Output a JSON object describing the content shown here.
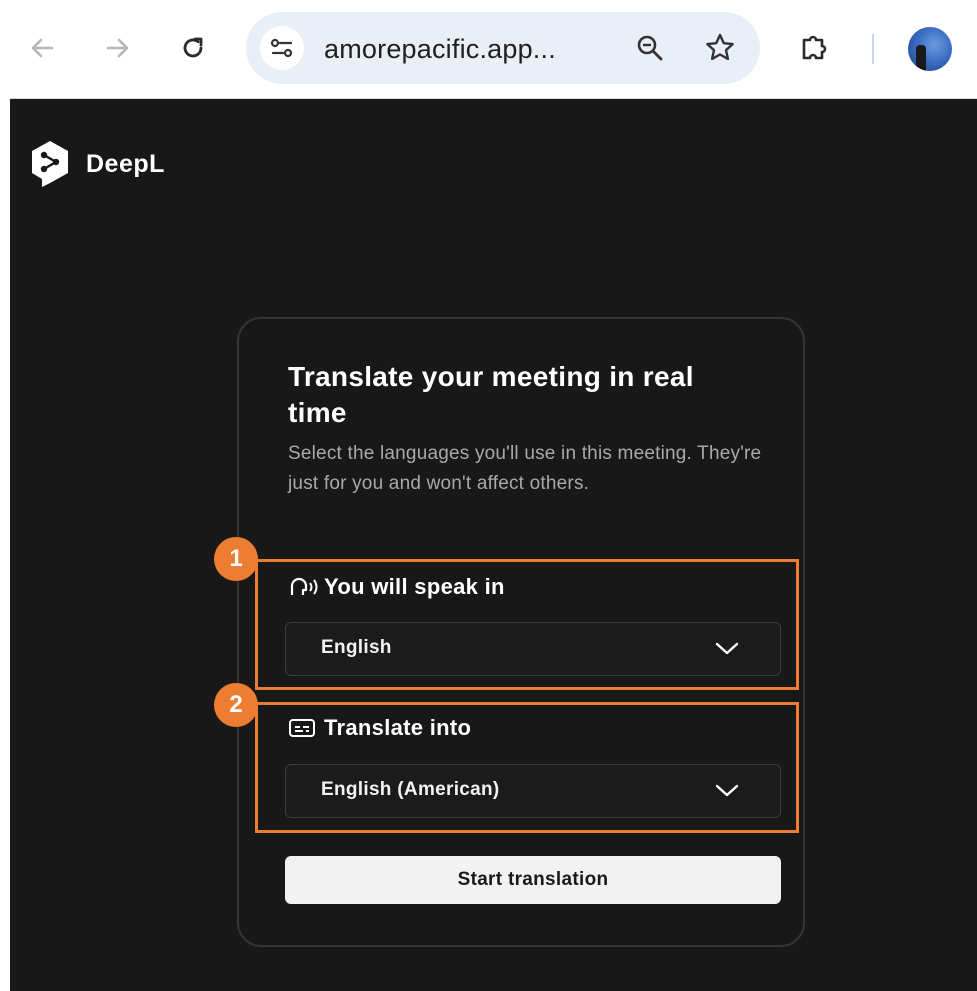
{
  "browser": {
    "url": "amorepacific.app...",
    "icons": [
      "back-arrow-icon",
      "forward-arrow-icon",
      "reload-icon",
      "site-settings-icon",
      "zoom-icon",
      "bookmark-star-icon",
      "extensions-puzzle-icon",
      "profile-avatar"
    ]
  },
  "app": {
    "brand": "DeepL",
    "card": {
      "title": "Translate your meeting in real time",
      "description": "Select the languages you'll use in this meeting. They're just for you and won't affect others.",
      "speak": {
        "label": "You will speak in",
        "value": "English"
      },
      "translate": {
        "label": "Translate into",
        "value": "English (American)"
      },
      "start_button": "Start translation"
    }
  },
  "annotations": [
    {
      "number": "1",
      "target": "speak-language-section"
    },
    {
      "number": "2",
      "target": "translate-language-section"
    }
  ],
  "colors": {
    "annotation": "#ed7d31",
    "background": "#181818",
    "button": "#f2f2f2",
    "omnibox": "#e9eef7"
  }
}
